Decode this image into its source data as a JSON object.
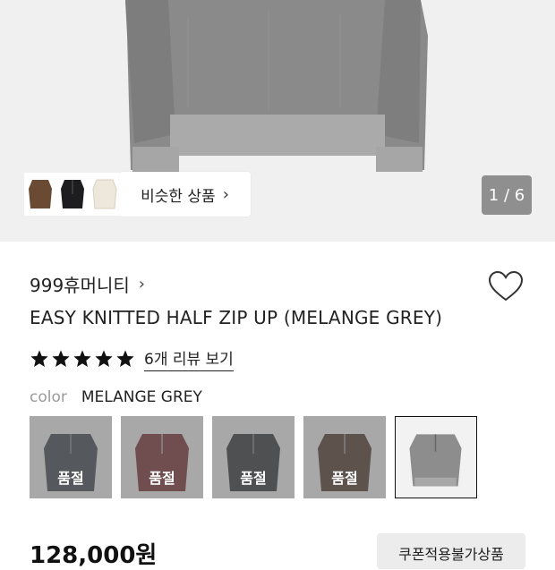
{
  "hero": {
    "counter": "1 / 6",
    "similar_button_label": "비슷한 상품",
    "chevron": "›",
    "thumbnail_colors": [
      "#6b4a33",
      "#1d1d20",
      "#eee7db"
    ]
  },
  "product": {
    "brand": "999휴머니티",
    "brand_chevron": "›",
    "name": "EASY KNITTED HALF ZIP UP (MELANGE GREY)",
    "stars": 5,
    "review_link": "6개 리뷰 보기",
    "color_label": "color",
    "color_value": "MELANGE GREY",
    "price": "128,000원",
    "coupon_button": "쿠폰적용불가상품"
  },
  "swatches": [
    {
      "color": "#3a3f46",
      "sold_out": true,
      "sold_out_label": "품절"
    },
    {
      "color": "#6a2a2c",
      "sold_out": true,
      "sold_out_label": "품절"
    },
    {
      "color": "#2f3134",
      "sold_out": true,
      "sold_out_label": "품절"
    },
    {
      "color": "#4a3329",
      "sold_out": true,
      "sold_out_label": "품절"
    },
    {
      "color": "#8d8d8d",
      "sold_out": false,
      "selected": true
    }
  ],
  "colors": {
    "accent": "#111111",
    "counter_bg": "#8f8f8f",
    "hero_bg": "#f0f0f0"
  }
}
